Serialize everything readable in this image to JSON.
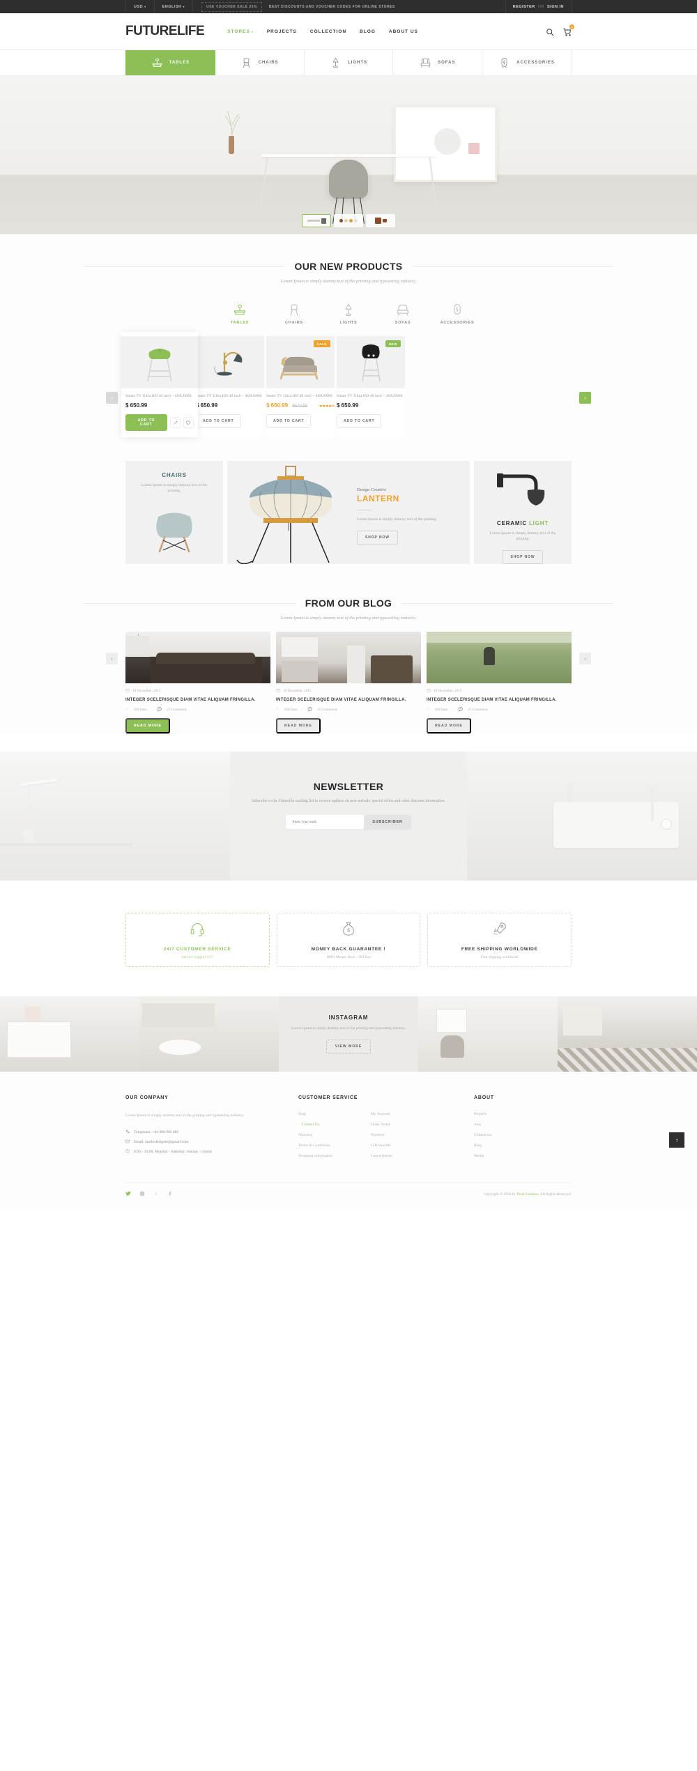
{
  "topbar": {
    "currency": "USD",
    "language": "ENGLISH",
    "voucher_badge": "USE VOUCHER SALE 25%",
    "voucher_text": "BEST DISCOUNTS AND VOUCHER CODES FOR ONLINE STORES",
    "register": "REGISTER",
    "or": "OR",
    "signin": "SIGN IN"
  },
  "header": {
    "logo": "FUTURELIFE",
    "nav": [
      {
        "label": "STORES",
        "active": true,
        "caret": true
      },
      {
        "label": "PROJECTS",
        "active": false,
        "caret": false
      },
      {
        "label": "COLLECTION",
        "active": false,
        "caret": false
      },
      {
        "label": "BLOG",
        "active": false,
        "caret": false
      },
      {
        "label": "ABOUT US",
        "active": false,
        "caret": false
      }
    ],
    "search_icon": "search-icon",
    "cart_icon": "cart-icon",
    "cart_count": "0"
  },
  "category_tabs": [
    {
      "label": "TABLES",
      "icon": "table-icon",
      "active": true
    },
    {
      "label": "CHAIRS",
      "icon": "chair-icon",
      "active": false
    },
    {
      "label": "LIGHTS",
      "icon": "lamp-icon",
      "active": false
    },
    {
      "label": "SOFAS",
      "icon": "sofa-icon",
      "active": false
    },
    {
      "label": "ACCESSORIES",
      "icon": "mirror-icon",
      "active": false
    }
  ],
  "hero": {
    "thumbnails": [
      {
        "name": "slide-thumb-desk",
        "active": true
      },
      {
        "name": "slide-thumb-knobs",
        "active": false
      },
      {
        "name": "slide-thumb-armchair",
        "active": false
      }
    ]
  },
  "products_section": {
    "title": "OUR NEW PRODUCTS",
    "subtitle": "Lorem Ipsum is simply dummy text of the printing and typesetting industry.",
    "filters": [
      {
        "label": "TABLES",
        "icon": "table-icon",
        "active": true
      },
      {
        "label": "CHAIRS",
        "icon": "chair-icon",
        "active": false
      },
      {
        "label": "LIGHTS",
        "icon": "lamp-icon",
        "active": false
      },
      {
        "label": "SOFAS",
        "icon": "sofa-icon",
        "active": false
      },
      {
        "label": "ACCESSORIES",
        "icon": "mirror-icon",
        "active": false
      }
    ],
    "prev_label": "‹",
    "next_label": "›",
    "add_to_cart": "ADD TO CART",
    "items": [
      {
        "title": "Smart TV Ultra HD 40 inch – 40JU6600",
        "price": "$ 650.99",
        "old_price": "",
        "badge": "",
        "rating": "",
        "hovered": true,
        "image": "green-bar-stool"
      },
      {
        "title": "Smart TV Ultra HD 40 inch – 40JU6600",
        "price": "$ 650.99",
        "old_price": "",
        "badge": "",
        "rating": "",
        "hovered": false,
        "image": "brass-desk-lamp"
      },
      {
        "title": "Smart TV Ultra HD 40 inch – 40JU6600",
        "price": "$ 650.99",
        "old_price": "$670.99",
        "badge": "SALE",
        "rating": "★★★★☆",
        "hovered": false,
        "image": "grey-sofa"
      },
      {
        "title": "Smart TV Ultra HD 40 inch – 40JU6600",
        "price": "$ 650.99",
        "old_price": "",
        "badge": "NEW",
        "rating": "",
        "hovered": false,
        "image": "black-bar-stool"
      }
    ]
  },
  "promos": {
    "chairs": {
      "title": "CHAIRS",
      "text": "Lorem Ipsum is simply dummy text of the printing."
    },
    "lantern": {
      "eyebrow": "Design Creative",
      "title": "LANTERN",
      "text": "Lorem Ipsum is simply dummy text of the printing.",
      "button": "SHOP NOW"
    },
    "ceramic": {
      "title_dark": "CERAMIC",
      "title_green": "LIGHT",
      "text": "Lorem Ipsum is simply dummy text of the printing.",
      "button": "SHOP NOW"
    }
  },
  "blog_section": {
    "title": "FROM OUR BLOG",
    "subtitle": "Lorem Ipsum is simply dummy text of the printing and typesetting industry.",
    "prev_label": "‹",
    "next_label": "›",
    "posts": [
      {
        "date": "16 December, 2015",
        "title": "INTEGER SCELERISQUE DIAM VITAE ALIQUAM FRINGILLA.",
        "likes": "100 likes",
        "comments": "25 Comments",
        "button": "READ MORE",
        "highlighted": true,
        "image": "living-room-sofa"
      },
      {
        "date": "16 December, 2015",
        "title": "INTEGER SCELERISQUE DIAM VITAE ALIQUAM FRINGILLA.",
        "likes": "100 likes",
        "comments": "25 Comments",
        "button": "READ MORE",
        "highlighted": false,
        "image": "kitchen-interior"
      },
      {
        "date": "16 December, 2015",
        "title": "INTEGER SCELERISQUE DIAM VITAE ALIQUAM FRINGILLA.",
        "likes": "100 likes",
        "comments": "25 Comments",
        "button": "READ MORE",
        "highlighted": false,
        "image": "field-grass"
      }
    ]
  },
  "scroll_top": "↑",
  "newsletter": {
    "title": "NEWSLETTER",
    "subtitle": "Subscribe to the Futurelife mailing list to receive updates on new arrivals, special offers and other discount information.",
    "placeholder": "Enter your mail.",
    "button": "SUBSCRIBER"
  },
  "services": [
    {
      "title": "24/7 CUSTOMER SERVICE",
      "subtitle": "Service Support 24/7",
      "icon": "headphones-icon",
      "active": true
    },
    {
      "title": "MONEY BACK GUARANTEE !",
      "subtitle": "100% Money Back - 30 Days",
      "icon": "money-bag-icon",
      "active": false
    },
    {
      "title": "FREE SHIPPING WORLDWIDE",
      "subtitle": "Free shipping worldwide",
      "icon": "rocket-icon",
      "active": false
    }
  ],
  "instagram": {
    "title": "INSTAGRAM",
    "subtitle": "Lorem Ipsum is simply dummy text of the printing and typesetting industry.",
    "button": "VIEW MORE"
  },
  "footer": {
    "company": {
      "heading": "OUR COMPANY",
      "description": "Lorem Ipsum is simply dummy text of the printing and typesetting industry.",
      "telephone": "Telephone: +84 988 992 085",
      "email": "Email: lamhvdesigner@gmail.com",
      "hours": "8:00 - 19:00, Monday - Saturday, Sunday - closed"
    },
    "customer_service": {
      "heading": "CUSTOMER SERVICE",
      "col1": [
        {
          "label": "Help",
          "active": false
        },
        {
          "label": "Contact Us",
          "active": true
        },
        {
          "label": "Warranty",
          "active": false
        },
        {
          "label": "Terms & Conditions",
          "active": false
        },
        {
          "label": "Shopping information",
          "active": false
        }
      ],
      "col2": [
        {
          "label": "My Account",
          "active": false
        },
        {
          "label": "Order Status",
          "active": false
        },
        {
          "label": "Payment",
          "active": false
        },
        {
          "label": "Gift Voucher",
          "active": false
        },
        {
          "label": "Cancellations",
          "active": false
        }
      ]
    },
    "about": {
      "heading": "ABOUT",
      "links": [
        {
          "label": "Projects",
          "active": false
        },
        {
          "label": "Jobs",
          "active": false
        },
        {
          "label": "Collections",
          "active": false
        },
        {
          "label": "Blog",
          "active": false
        },
        {
          "label": "Media",
          "active": false
        }
      ]
    },
    "socials": [
      {
        "name": "twitter-icon",
        "glyph": "🐦"
      },
      {
        "name": "skype-icon",
        "glyph": "S"
      },
      {
        "name": "vimeo-icon",
        "glyph": "V"
      },
      {
        "name": "facebook-icon",
        "glyph": "f"
      }
    ],
    "copyright_pre": "Copyright © 2016 by ",
    "copyright_brand": "Pixel-Creative",
    "copyright_post": ". All Rights Reserved."
  }
}
